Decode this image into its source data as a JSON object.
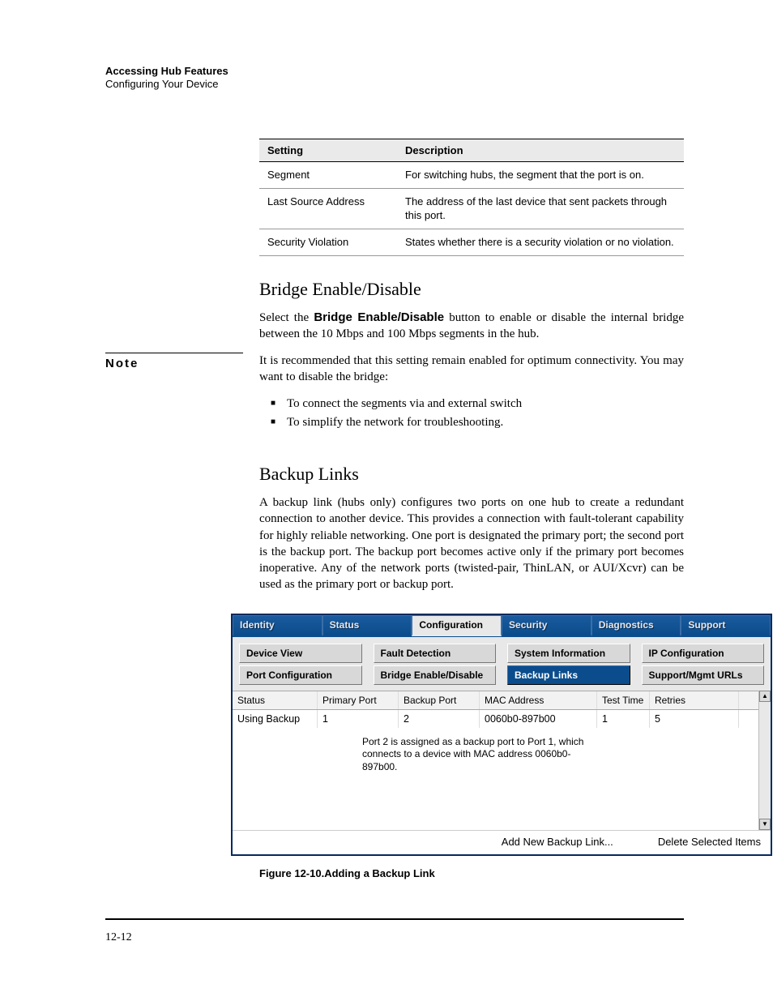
{
  "header": {
    "chapter": "Accessing Hub Features",
    "section": "Configuring Your Device"
  },
  "settings_table": {
    "head_setting": "Setting",
    "head_description": "Description",
    "rows": [
      {
        "setting": "Segment",
        "description": "For switching hubs, the segment that the port is on."
      },
      {
        "setting": "Last Source Address",
        "description": "The address of the last device that sent packets through this port."
      },
      {
        "setting": "Security Violation",
        "description": "States whether there is a security violation or no violation."
      }
    ]
  },
  "bridge": {
    "heading": "Bridge Enable/Disable",
    "para_intro_pre": "Select the ",
    "para_intro_bold": "Bridge Enable/Disable",
    "para_intro_post": " button to enable or disable the internal bridge between the 10 Mbps and 100 Mbps segments in the hub."
  },
  "note_label": "Note",
  "note": {
    "para": "It is recommended that this setting remain enabled for optimum connectivity. You may want to disable the bridge:",
    "bullets": [
      "To connect the segments via and external switch",
      "To simplify the network for troubleshooting."
    ]
  },
  "backup": {
    "heading": "Backup Links",
    "para": "A backup link (hubs only) configures two ports on one hub to create a redundant connection to another device. This provides a connection with fault-tolerant capability for highly reliable networking. One port is designated the primary port; the second port is the backup port. The backup port becomes active only if the primary port becomes inoperative. Any of the network ports (twisted-pair, ThinLAN, or AUI/Xcvr) can be used as the primary port or backup port."
  },
  "screenshot": {
    "main_tabs": [
      "Identity",
      "Status",
      "Configuration",
      "Security",
      "Diagnostics",
      "Support"
    ],
    "main_active_index": 2,
    "sub_tabs_row1": [
      "Device View",
      "Fault Detection",
      "System Information",
      "IP Configuration"
    ],
    "sub_tabs_row2": [
      "Port Configuration",
      "Bridge Enable/Disable",
      "Backup Links",
      "Support/Mgmt URLs"
    ],
    "sub_active_row": 2,
    "sub_active_index": 2,
    "columns": [
      "Status",
      "Primary Port",
      "Backup Port",
      "MAC Address",
      "Test Time",
      "Retries"
    ],
    "row": {
      "status": "Using Backup",
      "primary": "1",
      "backup": "2",
      "mac": "0060b0-897b00",
      "test": "1",
      "retries": "5"
    },
    "callout": "Port 2 is assigned as a backup port to Port 1, which connects to a device with MAC address 0060b0-897b00.",
    "btn_add": "Add New Backup Link...",
    "btn_delete": "Delete Selected Items"
  },
  "figure_caption": "Figure 12-10.Adding a Backup Link",
  "page_number": "12-12"
}
